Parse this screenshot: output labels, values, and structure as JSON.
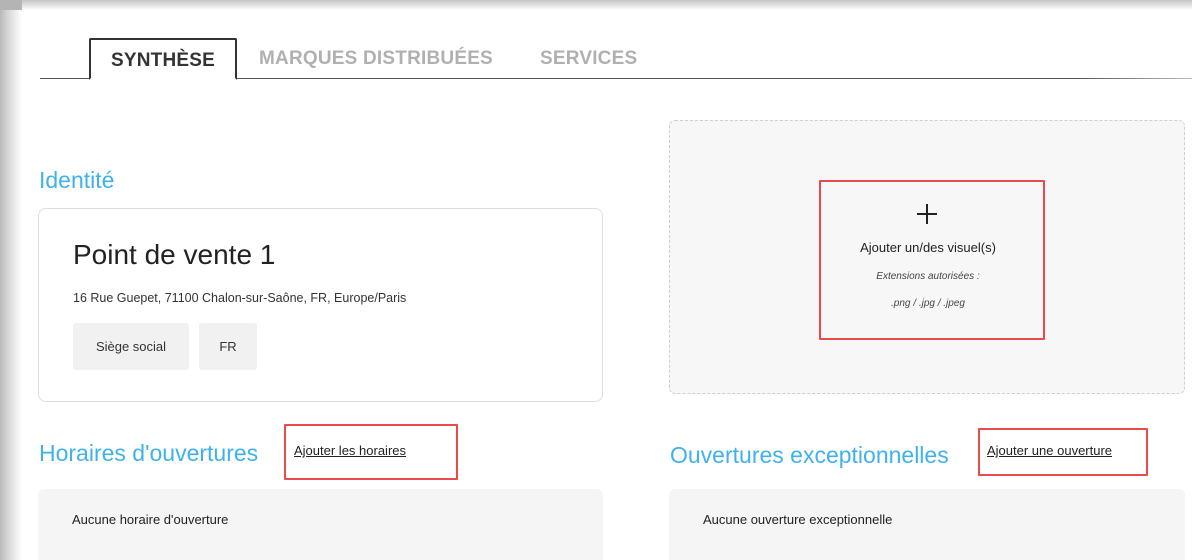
{
  "tabs": {
    "synthese": "SYNTHÈSE",
    "brands": "MARQUES DISTRIBUÉES",
    "services": "SERVICES"
  },
  "identity": {
    "title": "Identité",
    "name": "Point de vente 1",
    "address": "16 Rue Guepet, 71100 Chalon-sur-Saône, FR, Europe/Paris",
    "chips": [
      "Siège social",
      "FR"
    ]
  },
  "upload": {
    "icon": "plus-icon",
    "label": "Ajouter un/des visuel(s)",
    "extensions_title": "Extensions autorisées :",
    "extensions": ".png / .jpg / .jpeg"
  },
  "hours": {
    "title": "Horaires d'ouvertures",
    "add_link": "Ajouter les horaires",
    "empty_text": "Aucune horaire d'ouverture"
  },
  "exceptional": {
    "title": "Ouvertures exceptionnelles",
    "add_link": "Ajouter une ouverture",
    "empty_text": "Aucune ouverture exceptionnelle"
  },
  "colors": {
    "accent": "#3fb2ea",
    "highlight": "#ea4a4a"
  }
}
